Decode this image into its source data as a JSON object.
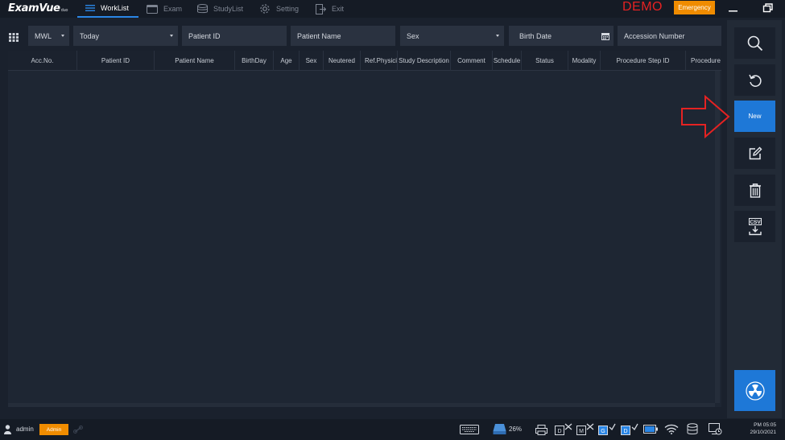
{
  "app": {
    "logo_text": "ExamVue",
    "logo_suffix": "duo"
  },
  "nav": [
    {
      "label": "WorkList",
      "icon": "list-icon",
      "active": true
    },
    {
      "label": "Exam",
      "icon": "monitor-icon",
      "active": false
    },
    {
      "label": "StudyList",
      "icon": "database-icon",
      "active": false
    },
    {
      "label": "Setting",
      "icon": "gear-icon",
      "active": false
    },
    {
      "label": "Exit",
      "icon": "exit-icon",
      "active": false
    }
  ],
  "header": {
    "demo_label": "DEMO",
    "emergency_label": "Emergency"
  },
  "filters": {
    "source": "MWL",
    "date_range": "Today",
    "patient_id": "Patient ID",
    "patient_name": "Patient Name",
    "sex": "Sex",
    "birth_date": "Birth Date",
    "accession_number": "Accession Number"
  },
  "table": {
    "columns": [
      "Acc.No.",
      "Patient ID",
      "Patient Name",
      "BirthDay",
      "Age",
      "Sex",
      "Neutered",
      "Ref.Physician",
      "Study Description",
      "Comment",
      "Schedule",
      "Status",
      "Modality",
      "Procedure Step ID",
      "Procedure"
    ],
    "rows": []
  },
  "toolbar": {
    "search": "search-icon",
    "refresh": "refresh-icon",
    "new_label": "New",
    "edit": "edit-icon",
    "delete": "trash-icon",
    "csv_label": "CSV",
    "radiation": "radiation-icon"
  },
  "status": {
    "user": "admin",
    "role_badge": "Admin",
    "disk_percent": "26%",
    "time": "PM 05:05",
    "date": "29/10/2021"
  },
  "colors": {
    "accent": "#1e78d7",
    "emergency": "#f08c00",
    "demo": "#e52222",
    "background": "#1a212d"
  }
}
